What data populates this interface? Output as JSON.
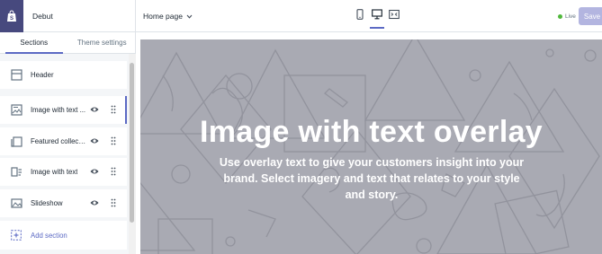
{
  "store": {
    "name": "Debut"
  },
  "tabs": [
    {
      "label": "Sections",
      "active": true
    },
    {
      "label": "Theme settings",
      "active": false
    }
  ],
  "sections": [
    {
      "label": "Header",
      "icon": "header-icon"
    },
    {
      "label": "Image with text ...",
      "icon": "image-with-text-overlay-icon",
      "selected": true
    },
    {
      "label": "Featured collecti...",
      "icon": "collection-icon"
    },
    {
      "label": "Image with text",
      "icon": "image-with-text-icon"
    },
    {
      "label": "Slideshow",
      "icon": "slideshow-icon"
    }
  ],
  "add_section": {
    "label": "Add section"
  },
  "topbar": {
    "page_select": "Home page",
    "status": "Live",
    "save_label": "Save",
    "devices": [
      "mobile-icon",
      "desktop-icon",
      "fullscreen-icon"
    ]
  },
  "hero": {
    "heading": "Image with text overlay",
    "text": "Use overlay text to give your customers insight into your brand. Select imagery and text that relates to your style and story."
  },
  "colors": {
    "accent": "#5c6ac4",
    "logo_bg": "#47497e",
    "live": "#50b83c",
    "save_disabled": "#b3b5e0",
    "preview_bg": "#a9aab3"
  }
}
